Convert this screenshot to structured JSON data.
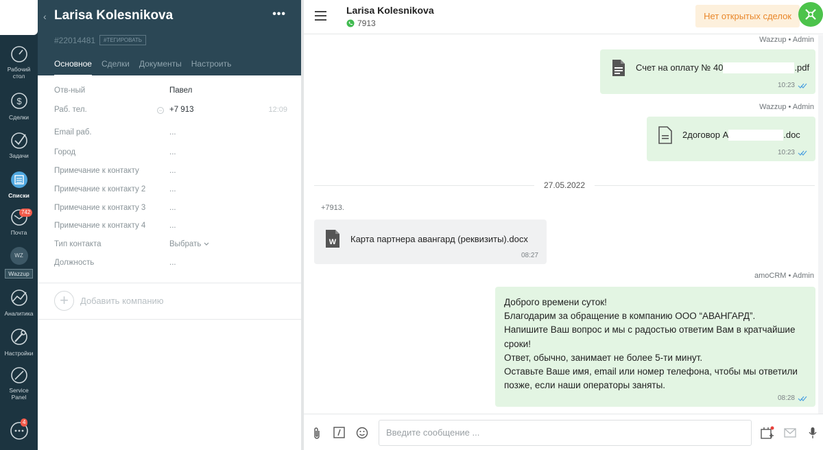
{
  "nav": {
    "items": [
      {
        "label_1": "Рабочий",
        "label_2": "стол",
        "icon": "dashboard-icon"
      },
      {
        "label_1": "Сделки",
        "icon": "deals-icon"
      },
      {
        "label_1": "Задачи",
        "icon": "tasks-icon"
      },
      {
        "label_1": "Списки",
        "icon": "lists-icon"
      },
      {
        "label_1": "Почта",
        "icon": "mail-icon",
        "badge": "742"
      },
      {
        "label_1": "Wazzup",
        "icon": "wazzup-icon",
        "circle": "WZ"
      },
      {
        "label_1": "Аналитика",
        "icon": "analytics-icon"
      },
      {
        "label_1": "Настройки",
        "icon": "settings-icon"
      },
      {
        "label_1": "Service",
        "label_2": "Panel",
        "icon": "service-panel-icon"
      },
      {
        "icon": "chat-icon",
        "badge": "4"
      }
    ]
  },
  "card": {
    "name": "Larisa Kolesnikova",
    "id": "#22014481",
    "tag_button": "#ТЕГИРОВАТЬ",
    "tabs": [
      "Основное",
      "Сделки",
      "Документы",
      "Настроить"
    ],
    "fields": [
      {
        "label": "Отв-ный",
        "value": "Павел"
      },
      {
        "label": "Раб. тел.",
        "value": "+7 913",
        "time": "12:09"
      },
      {
        "label": "Email раб.",
        "value": "..."
      },
      {
        "label": "Город",
        "value": "..."
      },
      {
        "label": "Примечание к контакту",
        "value": "..."
      },
      {
        "label": "Примечание к контакту 2",
        "value": "..."
      },
      {
        "label": "Примечание к контакту 3",
        "value": "..."
      },
      {
        "label": "Примечание к контакту 4",
        "value": "..."
      },
      {
        "label": "Тип контакта",
        "value": "Выбрать"
      },
      {
        "label": "Должность",
        "value": "..."
      }
    ],
    "add_company": "Добавить компанию"
  },
  "chat": {
    "contact_name": "Larisa Kolesnikova",
    "contact_phone": "7913",
    "deals_button": "Нет открытых сделок",
    "messages": [
      {
        "sender": "Wazzup • Admin",
        "file_prefix": "Счет на оплату № 40",
        "file_suffix": ".pdf",
        "time": "10:23"
      },
      {
        "sender": "Wazzup • Admin",
        "file_prefix": "2договор А",
        "file_suffix": ".doc",
        "time": "10:23"
      },
      {
        "date": "27.05.2022"
      },
      {
        "sender": "+7913.",
        "file_name": "Карта партнера авангард (реквизиты).docx",
        "time": "08:27"
      },
      {
        "sender": "amoCRM • Admin",
        "lines": [
          "Доброго времени суток!",
          "Благодарим за обращение в компанию ООО “АВАНГАРД”.",
          "Напишите Ваш вопрос и мы с радостью ответим Вам в кратчайшие",
          "сроки!",
          "Ответ, обычно, занимает не более 5-ти минут.",
          "Оставьте Ваше имя, email или номер телефона, чтобы мы ответили",
          "позже, если наши операторы заняты."
        ],
        "time": "08:28"
      }
    ],
    "composer_placeholder": "Введите сообщение ..."
  }
}
